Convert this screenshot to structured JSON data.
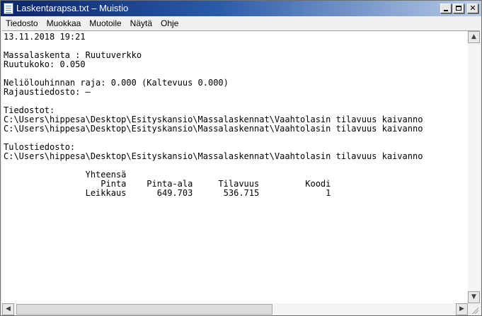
{
  "window": {
    "title": "Laskentarapsa.txt – Muistio",
    "buttons": {
      "minimize_icon": "minimize-icon",
      "maximize_icon": "maximize-icon",
      "close_label": "✕"
    }
  },
  "menu": {
    "items": [
      "Tiedosto",
      "Muokkaa",
      "Muotoile",
      "Näytä",
      "Ohje"
    ]
  },
  "editor": {
    "lines": [
      "13.11.2018 19:21",
      "",
      "Massalaskenta : Ruutuverkko",
      "Ruutukoko: 0.050",
      "",
      "Neliölouhinnan raja: 0.000 (Kaltevuus 0.000)",
      "Rajaustiedosto: –",
      "",
      "Tiedostot:",
      "C:\\Users\\hippesa\\Desktop\\Esityskansio\\Massalaskennat\\Vaahtolasin tilavuus kaivanno",
      "C:\\Users\\hippesa\\Desktop\\Esityskansio\\Massalaskennat\\Vaahtolasin tilavuus kaivanno",
      "",
      "Tulostiedosto:",
      "C:\\Users\\hippesa\\Desktop\\Esityskansio\\Massalaskennat\\Vaahtolasin tilavuus kaivanno",
      "",
      "                Yhteensä",
      "                   Pinta    Pinta-ala     Tilavuus         Koodi",
      "                Leikkaus      649.703      536.715             1"
    ]
  },
  "scrollbars": {
    "up_arrow": "▲",
    "down_arrow": "▼",
    "left_arrow": "◀",
    "right_arrow": "▶"
  },
  "colors": {
    "titlebar_start": "#0a246a",
    "titlebar_end": "#b9cbe6",
    "editor_background": "#ffffff",
    "chrome": "#f0f0f0"
  }
}
